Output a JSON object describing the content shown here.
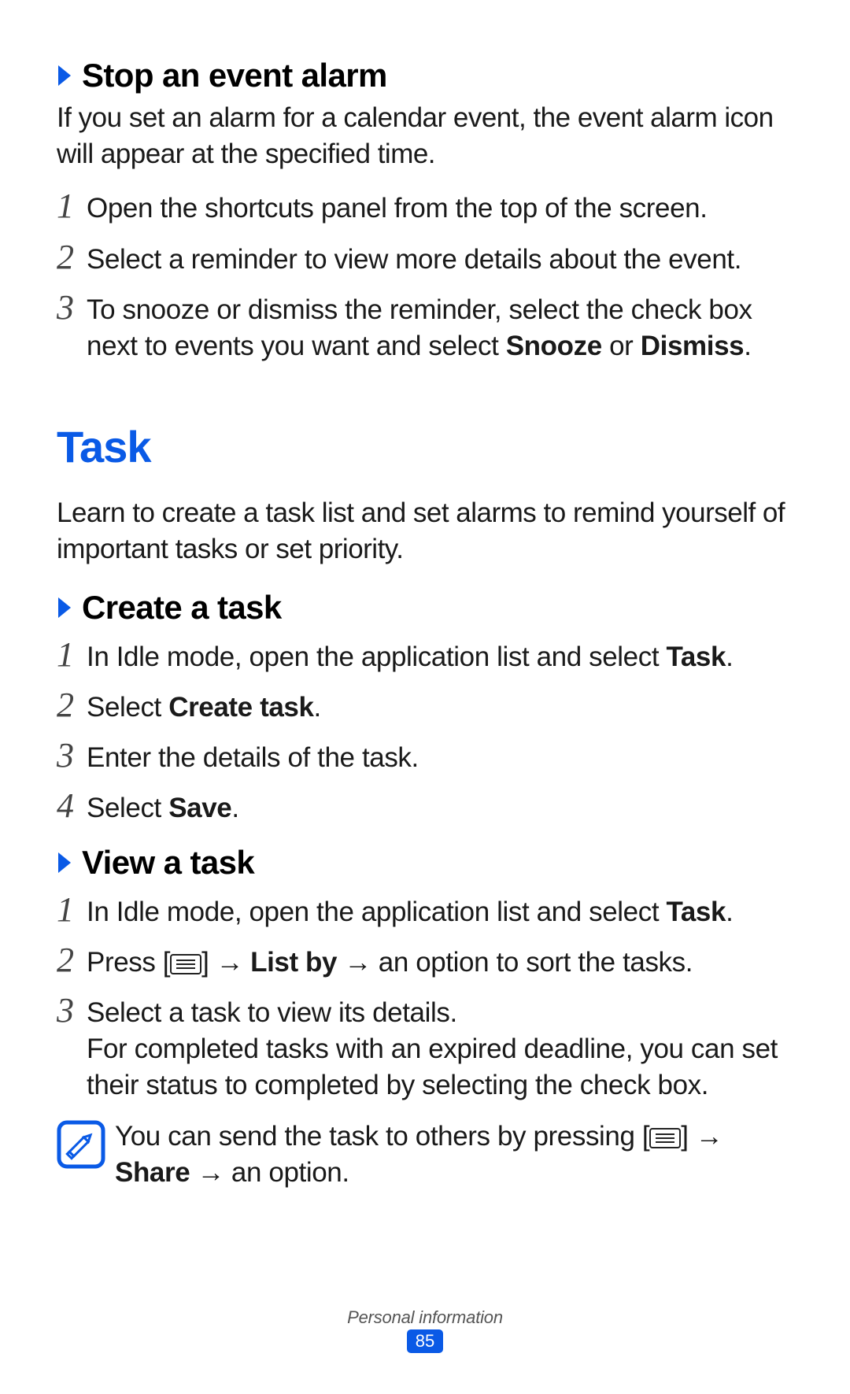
{
  "section_stop": {
    "heading": "Stop an event alarm",
    "intro": "If you set an alarm for a calendar event, the event alarm icon will appear at the specified time.",
    "steps": [
      {
        "n": "1",
        "text": "Open the shortcuts panel from the top of the screen."
      },
      {
        "n": "2",
        "text": "Select a reminder to view more details about the event."
      },
      {
        "n": "3",
        "text_prefix": "To snooze or dismiss the reminder, select the check box next to events you want and select ",
        "bold1": "Snooze",
        "middle": " or ",
        "bold2": "Dismiss",
        "suffix": "."
      }
    ]
  },
  "task_heading": "Task",
  "task_intro": "Learn to create a task list and set alarms to remind yourself of important tasks or set priority.",
  "section_create": {
    "heading": "Create a task",
    "steps": [
      {
        "n": "1",
        "prefix": "In Idle mode, open the application list and select ",
        "bold": "Task",
        "suffix": "."
      },
      {
        "n": "2",
        "prefix": "Select ",
        "bold": "Create task",
        "suffix": "."
      },
      {
        "n": "3",
        "text": "Enter the details of the task."
      },
      {
        "n": "4",
        "prefix": "Select ",
        "bold": "Save",
        "suffix": "."
      }
    ]
  },
  "section_view": {
    "heading": "View a task",
    "steps": [
      {
        "n": "1",
        "prefix": "In Idle mode, open the application list and select ",
        "bold": "Task",
        "suffix": "."
      },
      {
        "n": "2",
        "prefix": "Press [",
        "after_icon": "] ",
        "arrow1": "→",
        "bold": " List by ",
        "arrow2": "→",
        "suffix": " an option to sort the tasks."
      },
      {
        "n": "3",
        "text": "Select a task to view its details.",
        "extra": "For completed tasks with an expired deadline, you can set their status to completed by selecting the check box."
      }
    ],
    "note": {
      "prefix": "You can send the task to others by pressing [",
      "after_icon": "] ",
      "arrow": "→",
      "br_bold": "Share ",
      "arrow2": "→",
      "suffix": " an option."
    }
  },
  "footer": {
    "section": "Personal information",
    "page": "85"
  }
}
